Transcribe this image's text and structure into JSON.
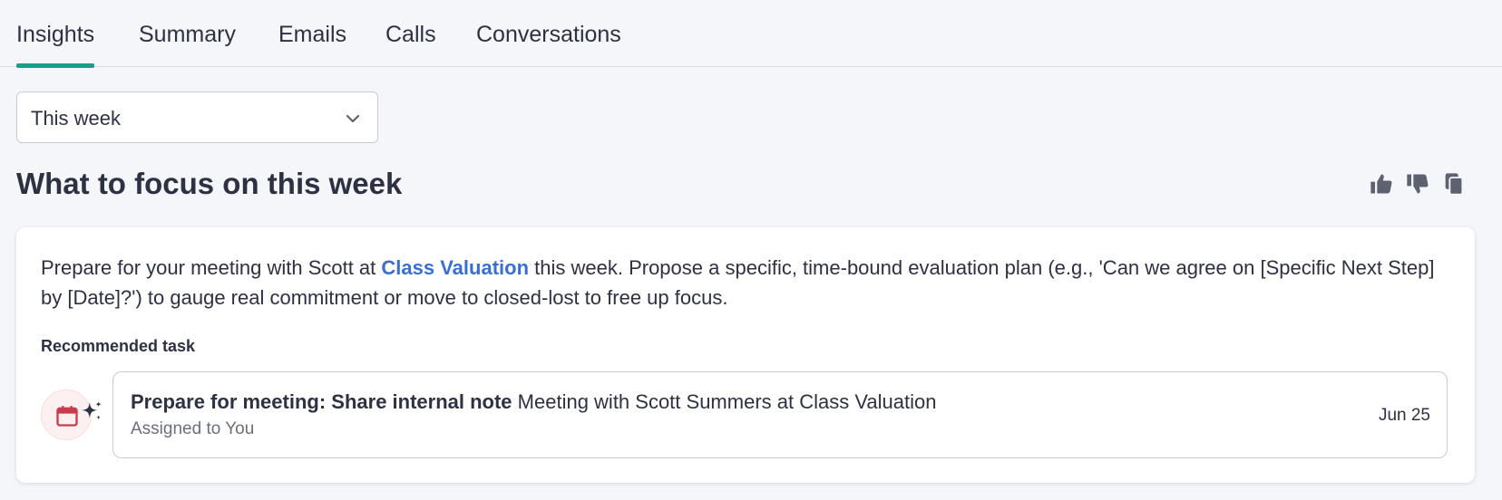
{
  "tabs": [
    {
      "label": "Insights",
      "active": true
    },
    {
      "label": "Summary",
      "active": false
    },
    {
      "label": "Emails",
      "active": false
    },
    {
      "label": "Calls",
      "active": false
    },
    {
      "label": "Conversations",
      "active": false
    }
  ],
  "period_select": {
    "value": "This week",
    "icon": "chevron-down-icon"
  },
  "section": {
    "title": "What to focus on this week",
    "actions": [
      "thumbs-up-icon",
      "thumbs-down-icon",
      "copy-icon"
    ]
  },
  "insight": {
    "text_before": "Prepare for your meeting with Scott at ",
    "company": "Class Valuation",
    "text_after": " this week. Propose a specific, time-bound evaluation plan (e.g., 'Can we agree on [Specific Next Step] by [Date]?') to gauge real commitment or move to closed-lost to free up focus."
  },
  "recommended": {
    "label": "Recommended task",
    "task": {
      "title_bold": "Prepare for meeting: Share internal note",
      "title_rest": " Meeting with Scott Summers at Class Valuation",
      "assigned": "Assigned to You",
      "date": "Jun 25",
      "icons": [
        "calendar-icon",
        "sparkle-icon"
      ]
    }
  },
  "colors": {
    "accent": "#14a08c",
    "link": "#3a6fd0",
    "calendar": "#c83c4c",
    "background": "#f5f6fa"
  }
}
